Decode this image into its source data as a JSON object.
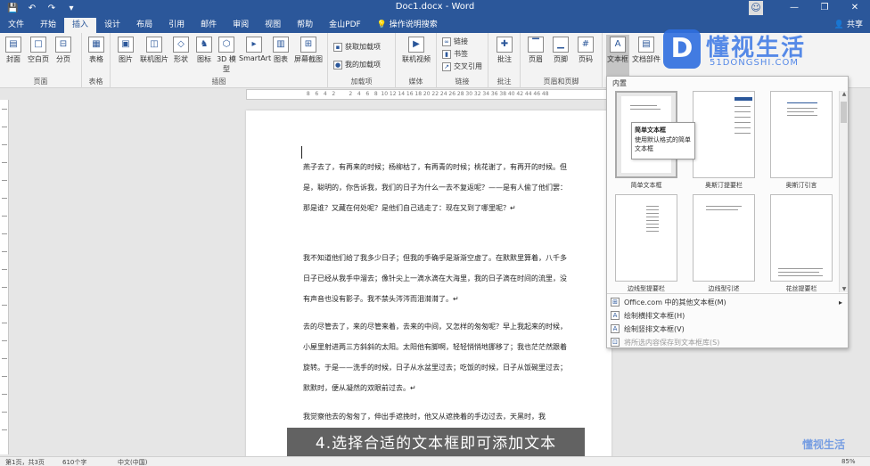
{
  "titlebar": {
    "doc_title": "Doc1.docx - Word",
    "save_icon": "💾",
    "undo_icon": "↶",
    "redo_icon": "↷",
    "qat_more_icon": "▾",
    "minimize": "—",
    "restore": "❐",
    "close": "✕"
  },
  "tabs": [
    "文件",
    "开始",
    "插入",
    "设计",
    "布局",
    "引用",
    "邮件",
    "审阅",
    "视图",
    "帮助",
    "金山PDF"
  ],
  "tell_me": "操作说明搜索",
  "share": "共享",
  "ribbon": {
    "pages": {
      "label": "页面",
      "cover": "封面",
      "blank": "空白页",
      "break": "分页"
    },
    "tables": {
      "label": "表格",
      "table": "表格"
    },
    "illustrations": {
      "label": "插图",
      "picture": "图片",
      "online_picture": "联机图片",
      "shapes": "形状",
      "icons": "图标",
      "models3d": "3D 模型",
      "smartart": "SmartArt",
      "chart": "图表",
      "screenshot": "屏幕截图"
    },
    "addins": {
      "label": "加载项",
      "get": "获取加载项",
      "my": "我的加载项"
    },
    "media": {
      "label": "媒体",
      "online_video": "联机视频"
    },
    "links": {
      "label": "链接",
      "link": "链接",
      "bookmark": "书签",
      "crossref": "交叉引用"
    },
    "comments": {
      "label": "批注",
      "comment": "批注"
    },
    "header_footer": {
      "label": "页眉和页脚",
      "header": "页眉",
      "footer": "页脚",
      "page_number": "页码"
    },
    "text": {
      "textbox": "文本框",
      "parts": "文档部件"
    }
  },
  "ruler_ticks": [
    "8",
    "6",
    "4",
    "2",
    "",
    "2",
    "4",
    "6",
    "8",
    "10",
    "12",
    "14",
    "16",
    "18",
    "20",
    "22",
    "24",
    "26",
    "28",
    "30",
    "32",
    "34",
    "36",
    "38",
    "40",
    "42",
    "44",
    "46",
    "48"
  ],
  "document": {
    "paragraphs": [
      "燕子去了，有再来的时候；杨柳枯了，有再青的时候；桃花谢了，有再开的时候。但是，聪明的，你告诉我，我们的日子为什么一去不复返呢？——是有人偷了他们罢：那是谁？又藏在何处呢？是他们自己逃走了：现在又到了哪里呢？↵",
      "我不知道他们给了我多少日子；但我的手确乎是渐渐空虚了。在默默里算着，八千多日子已经从我手中溜去；像针尖上一滴水滴在大海里，我的日子滴在时间的流里，没有声音也没有影子。我不禁头涔涔而泪潸潸了。↵",
      "去的尽管去了，来的尽管来着，去来的中间，又怎样的匆匆呢？早上我起来的时候，小屋里射进两三方斜斜的太阳。太阳他有脚啊，轻轻悄悄地挪移了；我也茫茫然跟着旋转。于是——洗手的时候，日子从水盆里过去；吃饭的时候，日子从饭碗里过去；默默时，便从凝然的双眼前过去。↵",
      "我觉察他去的匆匆了，伸出手遮挽时，他又从遮挽着的手边过去，天黑时，我"
    ]
  },
  "gallery": {
    "header": "内置",
    "items": [
      "简单文本框",
      "奥斯汀提要栏",
      "奥斯汀引言",
      "边线型提要栏",
      "边线型引述",
      "花丝提要栏"
    ],
    "tooltip_title": "简单文本框",
    "tooltip_desc": "使用默认格式的简单文本框",
    "menu": [
      {
        "label": "Office.com 中的其他文本框(M)",
        "icon": "⊞",
        "arrow": "▸",
        "disabled": false
      },
      {
        "label": "绘制横排文本框(H)",
        "icon": "A",
        "arrow": "",
        "disabled": false
      },
      {
        "label": "绘制竖排文本框(V)",
        "icon": "A",
        "arrow": "",
        "disabled": false
      },
      {
        "label": "将所选内容保存到文本框库(S)",
        "icon": "⊡",
        "arrow": "",
        "disabled": true
      }
    ]
  },
  "watermark": {
    "text": "懂视生活",
    "sub": "51DONGSHI.COM",
    "mark": "D"
  },
  "subtitle": "4.选择合适的文本框即可添加文本",
  "status": {
    "page": "第1页，共3页",
    "words": "610个字",
    "lang": "中文(中国)",
    "zoom": "85%"
  },
  "corner_logo": "懂视生活"
}
